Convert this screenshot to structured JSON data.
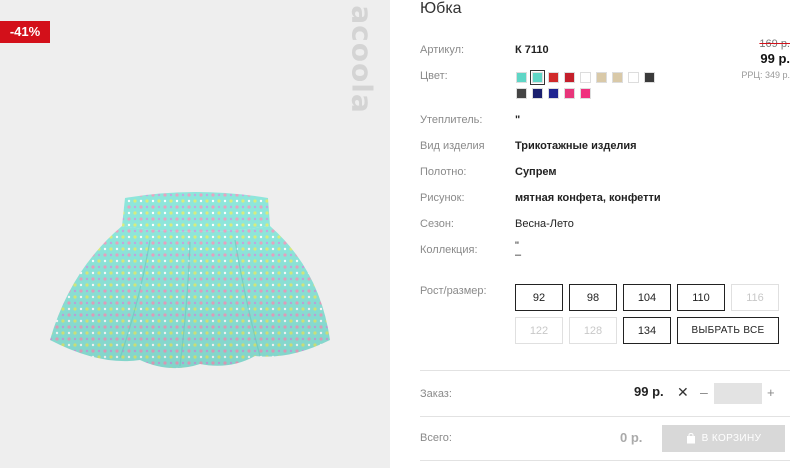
{
  "badge": {
    "discount": "-41%"
  },
  "logo": {
    "text": "acoola"
  },
  "product": {
    "title": "Юбка",
    "article_label": "Артикул:",
    "article_value": "К 7110",
    "color_label": "Цвет:",
    "insulation_label": "Утеплитель:",
    "insulation_value": "\"",
    "type_label": "Вид изделия",
    "type_value": "Трикотажные изделия",
    "fabric_label": "Полотно:",
    "fabric_value": "Супрем",
    "pattern_label": "Рисунок:",
    "pattern_value": "мятная конфета, конфетти",
    "season_label": "Сезон:",
    "season_value": "Весна-Лето",
    "collection_label": "Коллекция:",
    "collection_value_1": "\"",
    "collection_value_2": "–",
    "size_label": "Рост/размер:"
  },
  "price": {
    "old": "169 р.",
    "new": "99 р.",
    "rrp": "РРЦ: 349 р."
  },
  "colors": [
    {
      "hex": "#5fd6c6",
      "selected": false
    },
    {
      "hex": "#5fd6c6",
      "selected": true
    },
    {
      "hex": "#d12a2a",
      "selected": false
    },
    {
      "hex": "#c41f2b",
      "selected": false
    },
    {
      "hex": "#ffffff",
      "selected": false
    },
    {
      "hex": "#d9c9a8",
      "selected": false
    },
    {
      "hex": "#d9c9a8",
      "selected": false
    },
    {
      "hex": "#ffffff",
      "selected": false
    },
    {
      "hex": "#3a3a3a",
      "selected": false
    },
    {
      "hex": "#444444",
      "selected": false
    },
    {
      "hex": "#1a1f6e",
      "selected": false
    },
    {
      "hex": "#1f2590",
      "selected": false
    },
    {
      "hex": "#e8357a",
      "selected": false
    },
    {
      "hex": "#f0307e",
      "selected": false
    }
  ],
  "sizes": [
    {
      "label": "92",
      "available": true
    },
    {
      "label": "98",
      "available": true
    },
    {
      "label": "104",
      "available": true
    },
    {
      "label": "110",
      "available": true
    },
    {
      "label": "116",
      "available": false
    },
    {
      "label": "122",
      "available": false
    },
    {
      "label": "128",
      "available": false
    },
    {
      "label": "134",
      "available": true
    }
  ],
  "select_all_label": "ВЫБРАТЬ ВСЕ",
  "order": {
    "label": "Заказ:",
    "price": "99 р.",
    "times": "✕",
    "minus": "–",
    "plus": "+",
    "qty_value": ""
  },
  "total": {
    "label": "Всего:",
    "value": "0 р.",
    "cart_button": "В КОРЗИНУ"
  }
}
